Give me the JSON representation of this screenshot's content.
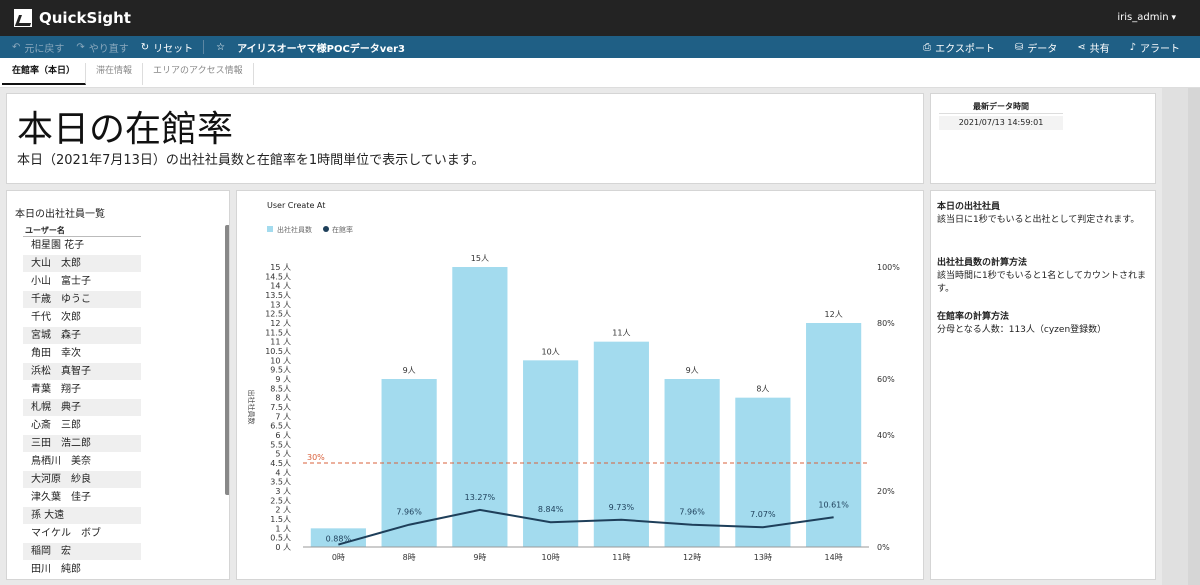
{
  "app": {
    "name": "QuickSight",
    "user": "iris_admin"
  },
  "toolbar": {
    "undo": "元に戻す",
    "redo": "やり直す",
    "reset": "リセット",
    "title": "アイリスオーヤマ様POCデータver3",
    "export": "エクスポート",
    "data": "データ",
    "share": "共有",
    "alert": "アラート"
  },
  "tabs": [
    "在館率（本日）",
    "滞在情報",
    "エリアのアクセス情報"
  ],
  "header": {
    "title": "本日の在館率",
    "subtitle": "本日（2021年7月13日）の出社社員数と在館率を1時間単位で表示しています。"
  },
  "latest": {
    "label": "最新データ時間",
    "value": "2021/07/13 14:59:01"
  },
  "user_list": {
    "title": "本日の出社社員一覧",
    "column": "ユーザー名",
    "rows": [
      "相星園 花子",
      "大山　太郎",
      "小山　富士子",
      "千歳　ゆうこ",
      "千代　次郎",
      "宮城　森子",
      "角田　幸次",
      "浜松　真智子",
      "青葉　翔子",
      "札幌　典子",
      "心斎　三郎",
      "三田　浩二郎",
      "鳥栖川　美奈",
      "大河原　紗良",
      "津久葉　佳子",
      "孫 大遠",
      "マイケル　ボブ",
      "稲岡　宏",
      "田川　純郎"
    ]
  },
  "chart_data": {
    "type": "bar",
    "title": "User Create At",
    "legend": [
      "出社社員数",
      "在館率"
    ],
    "legend_position": "top-left",
    "ylabel": "出社社員数",
    "categories": [
      "0時",
      "8時",
      "9時",
      "10時",
      "11時",
      "12時",
      "13時",
      "14時"
    ],
    "series": [
      {
        "name": "出社社員数",
        "type": "bar",
        "values": [
          1,
          9,
          15,
          10,
          11,
          9,
          8,
          12
        ],
        "labels": [
          "",
          "9人",
          "15人",
          "10人",
          "11人",
          "9人",
          "8人",
          "12人"
        ]
      },
      {
        "name": "在館率",
        "type": "line",
        "values": [
          0.88,
          7.96,
          13.27,
          8.84,
          9.73,
          7.96,
          7.07,
          10.61
        ],
        "labels": [
          "0.88%",
          "7.96%",
          "13.27%",
          "8.84%",
          "9.73%",
          "7.96%",
          "7.07%",
          "10.61%"
        ]
      }
    ],
    "y_left_ticks": [
      "0 人",
      "0.5人",
      "1 人",
      "1.5人",
      "2 人",
      "2.5人",
      "3 人",
      "3.5人",
      "4 人",
      "4.5人",
      "5 人",
      "5.5人",
      "6 人",
      "6.5人",
      "7 人",
      "7.5人",
      "8 人",
      "8.5人",
      "9 人",
      "9.5人",
      "10 人",
      "10.5人",
      "11 人",
      "11.5人",
      "12 人",
      "12.5人",
      "13 人",
      "13.5人",
      "14 人",
      "14.5人",
      "15 人"
    ],
    "y_left_labels": [
      "0 人",
      "0.5人",
      "1 人",
      "1.5人",
      "2 人",
      "2.5人",
      "3 人",
      "3.5人",
      "4 人",
      "4.5人",
      "5 人",
      "5.5人",
      "6 人",
      "6.5人",
      "7 人",
      "7.5人",
      "8 人",
      "8.5人",
      "9 人",
      "9.5人",
      "10 人",
      "10.5人",
      "11 人",
      "11.5人",
      "12 人",
      "12.5人",
      "13 人",
      "13.5人",
      "14 人",
      "14.5人",
      "15 人"
    ],
    "ylim_left": [
      0,
      15
    ],
    "y_right_labels": [
      "0%",
      "20%",
      "40%",
      "60%",
      "80%",
      "100%"
    ],
    "ylim_right": [
      0,
      100
    ],
    "reference_line": {
      "label": "30%",
      "value": 30
    },
    "colors": {
      "bar": "#a3dbee",
      "line": "#1e3f5a",
      "reference": "#d9603b"
    }
  },
  "notes": [
    {
      "heading": "本日の出社社員",
      "body": "該当日に1秒でもいると出社として判定されます。"
    },
    {
      "heading": "出社社員数の計算方法",
      "body": "該当時間に1秒でもいると1名としてカウントされます。"
    },
    {
      "heading": "在館率の計算方法",
      "body": "分母となる人数：113人（cyzen登録数）"
    }
  ]
}
